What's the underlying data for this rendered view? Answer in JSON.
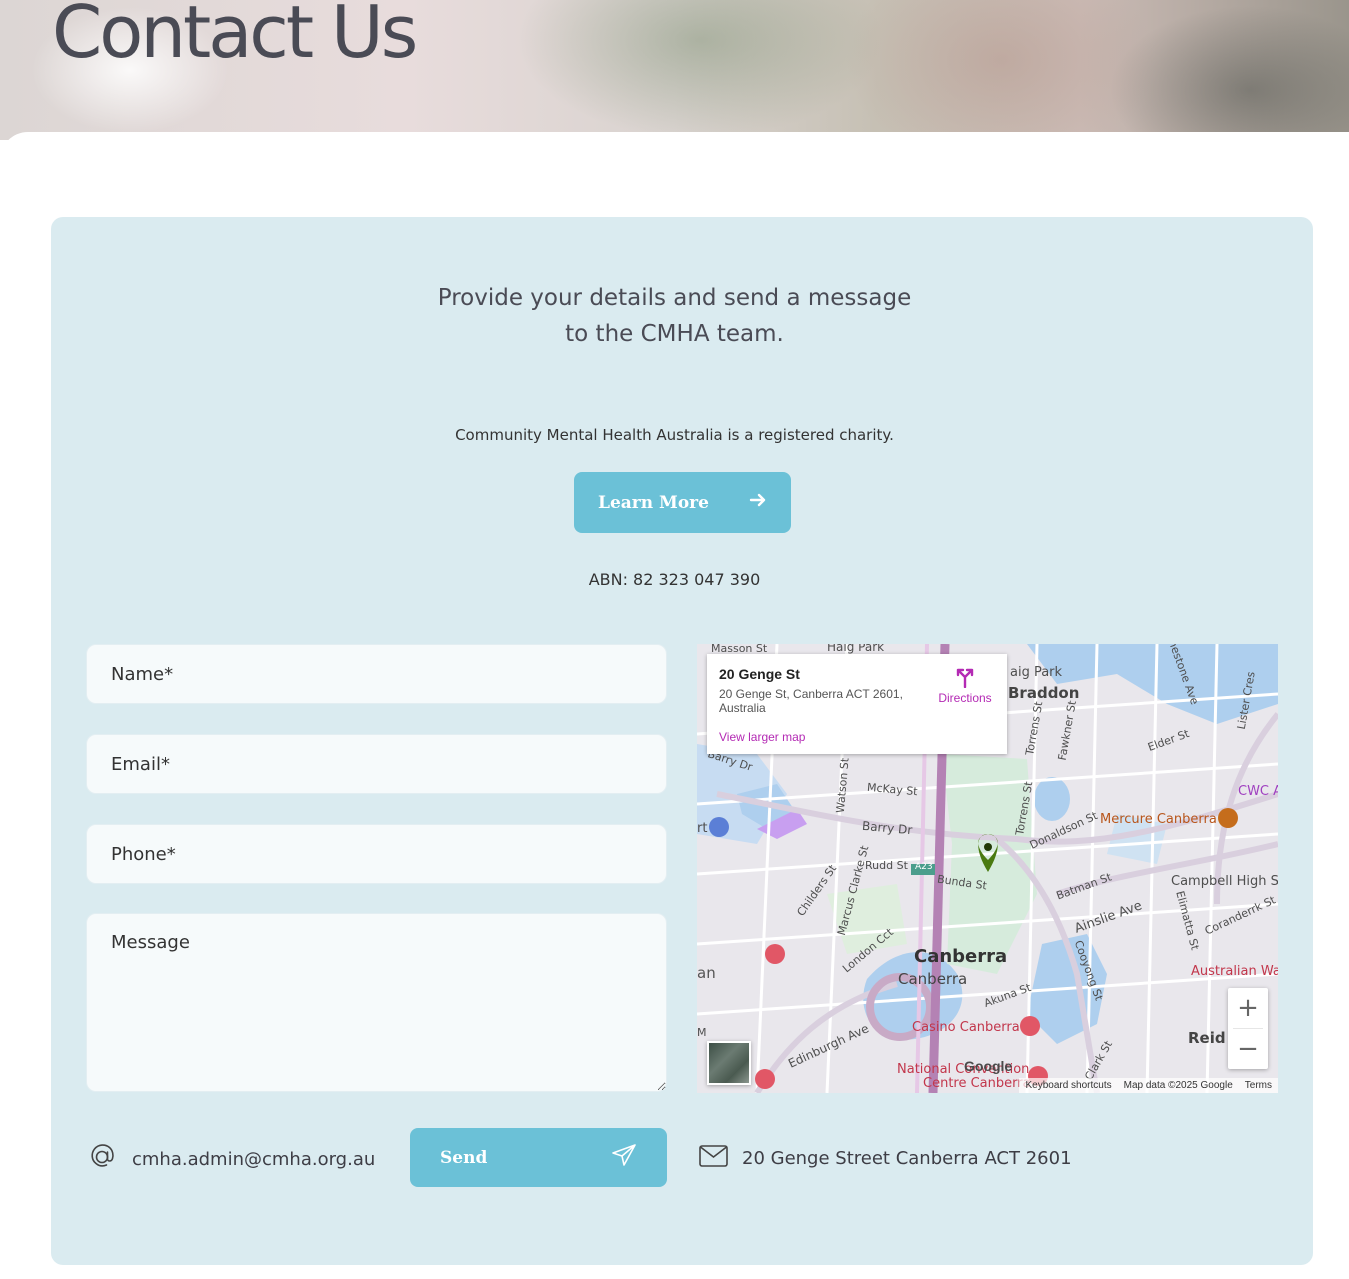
{
  "hero": {
    "title": "Contact Us"
  },
  "intro": {
    "line1": "Provide your details and send a message",
    "line2": "to the CMHA team."
  },
  "charity_text": "Community Mental Health Australia is a registered charity.",
  "learn_more_label": "Learn More",
  "abn": "ABN: 82 323 047 390",
  "form": {
    "name_placeholder": "Name*",
    "email_placeholder": "Email*",
    "phone_placeholder": "Phone*",
    "message_placeholder": "Message",
    "send_label": "Send"
  },
  "contact": {
    "email": "cmha.admin@cmha.org.au",
    "address": "20 Genge Street Canberra ACT 2601"
  },
  "map": {
    "info_title": "20 Genge St",
    "info_address": "20 Genge St, Canberra ACT 2601, Australia",
    "directions": "Directions",
    "view_larger": "View larger map",
    "zoom_in": "+",
    "zoom_out": "−",
    "footer_shortcuts": "Keyboard shortcuts",
    "footer_data": "Map data ©2025 Google",
    "footer_terms": "Terms",
    "google": "Google",
    "labels": {
      "masson": "Masson St",
      "haig_park": "Haig Park",
      "haig_park2": "aig Park",
      "braddon": "Braddon",
      "barry_dr": "Barry Dr",
      "barry_dr2": "Barry Dr",
      "mckay": "McKay St",
      "rudd": "Rudd St",
      "bunda": "Bunda St",
      "a23": "A23",
      "marcus": "Marcus Clarke St",
      "childers": "Childers St",
      "watson": "Watson St",
      "torrens": "Torrens St",
      "torrens2": "Torrens St",
      "fawkner": "Fawkner St",
      "donaldson": "Donaldson St",
      "mercure": "Mercure Canberra",
      "cwc": "CWC A",
      "elder": "Elder St",
      "lister": "Lister Cres",
      "limestone": "mestone Ave",
      "campbell": "Campbell High Sc",
      "batman": "Batman St",
      "ainslie": "Ainslie Ave",
      "elimatta": "Elimatta St",
      "corandeirk": "Coranderrk St",
      "australian_war": "Australian Wa",
      "canberra_big": "Canberra",
      "canberra_small": "Canberra",
      "london": "London Cct",
      "akuna": "Akuna St",
      "cooyong": "Cooyong St",
      "casino": "Casino Canberra",
      "reid": "Reid",
      "edinburgh": "Edinburgh Ave",
      "national": "National Convention",
      "centre": "Centre Canberra",
      "an": "an",
      "rt": "rt",
      "m": "M",
      "clark": "Clark St"
    }
  }
}
